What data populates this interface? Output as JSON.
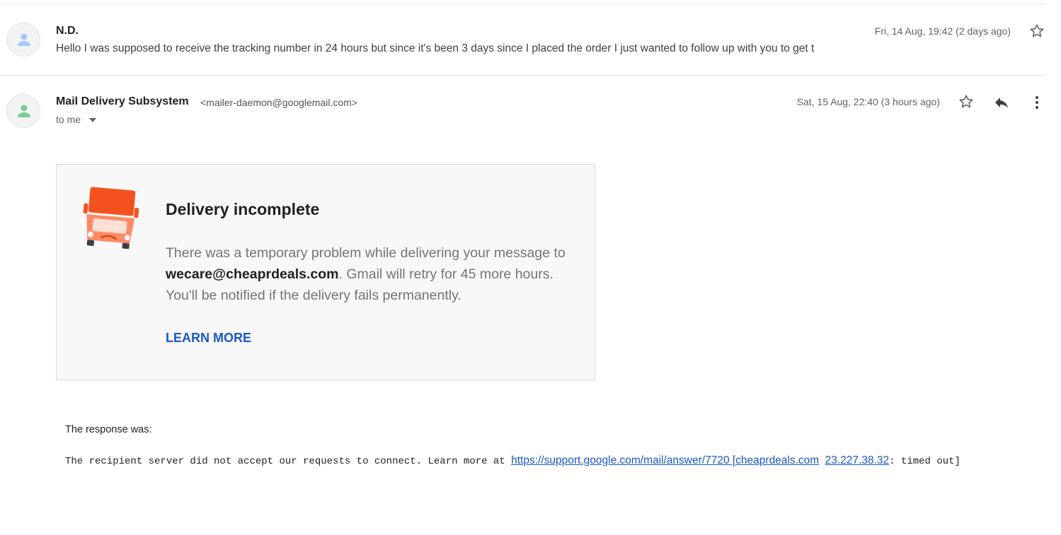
{
  "thread": {
    "previous_message": {
      "sender": "N.D.",
      "snippet": "Hello I was supposed to receive the tracking number in 24 hours but since it's been 3 days since I placed the order I just wanted to follow up with you to get t",
      "date": "Fri, 14 Aug, 19:42 (2 days ago)"
    },
    "current_message": {
      "sender": "Mail Delivery Subsystem",
      "sender_email": "<mailer-daemon@googlemail.com>",
      "recipient_label": "to me",
      "date": "Sat, 15 Aug, 22:40 (3 hours ago)"
    }
  },
  "notice": {
    "title": "Delivery incomplete",
    "body_before": "There was a temporary problem while delivering your message to ",
    "recipient": "wecare@cheaprdeals.com",
    "body_after": ". Gmail will retry for 45 more hours. You'll be notified if the delivery fails permanently.",
    "learn_more": "LEARN MORE"
  },
  "response": {
    "label": "The response was:",
    "text_before": "The recipient server did not accept our requests to connect. Learn more at ",
    "link1": "https://support.google.com/mail/answer/7720 [cheaprdeals.com",
    "link2": "23.227.38.32",
    "text_after": ": timed out]"
  },
  "icons": {
    "avatar_1": "person-icon",
    "avatar_2": "person-icon",
    "star": "star-outline-icon",
    "reply": "reply-icon",
    "more": "more-vert-icon",
    "caret": "caret-down-icon",
    "truck": "sad-truck-icon"
  },
  "colors": {
    "avatar_1": "#a8c7fa",
    "avatar_2": "#81c995",
    "truck_top": "#f4511e",
    "truck_body": "#ff8a65",
    "link": "#1a57c6"
  }
}
